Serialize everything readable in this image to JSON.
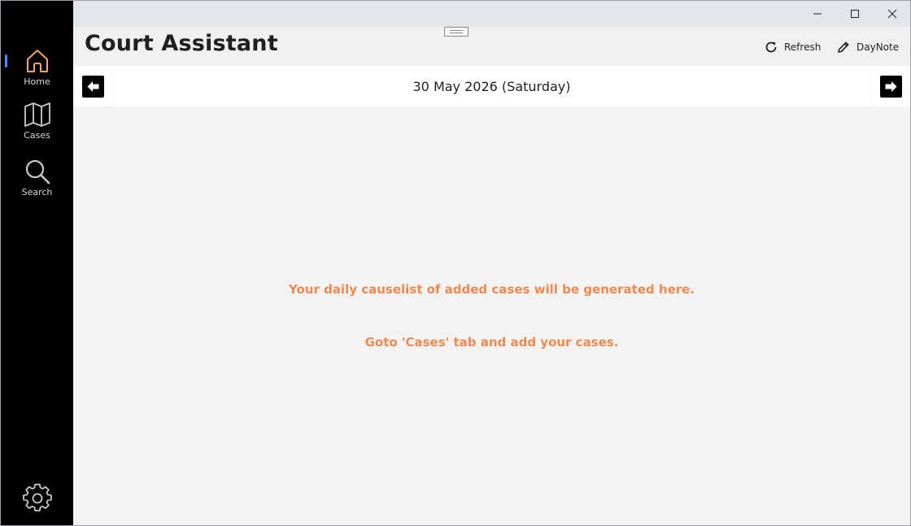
{
  "sidebar": {
    "items": [
      {
        "label": "Home",
        "icon": "home-icon",
        "active": true,
        "icon_color": "#f2a65a"
      },
      {
        "label": "Cases",
        "icon": "map-icon",
        "active": false
      },
      {
        "label": "Search",
        "icon": "search-icon",
        "active": false
      }
    ],
    "settings_icon": "gear-icon",
    "indicator_color": "#4c8dff"
  },
  "window_controls": [
    "minimize",
    "maximize",
    "close"
  ],
  "header": {
    "title": "Court Assistant",
    "refresh_label": "Refresh",
    "daynote_label": "DayNote"
  },
  "datebar": {
    "date": "30 May 2026 (Saturday)",
    "prev_icon": "arrow-left-icon",
    "next_icon": "arrow-right-icon"
  },
  "content": {
    "message_1": "Your daily causelist of added cases will be generated here.",
    "message_2": "Goto 'Cases' tab and add your cases.",
    "message_color": "#f08a50"
  }
}
